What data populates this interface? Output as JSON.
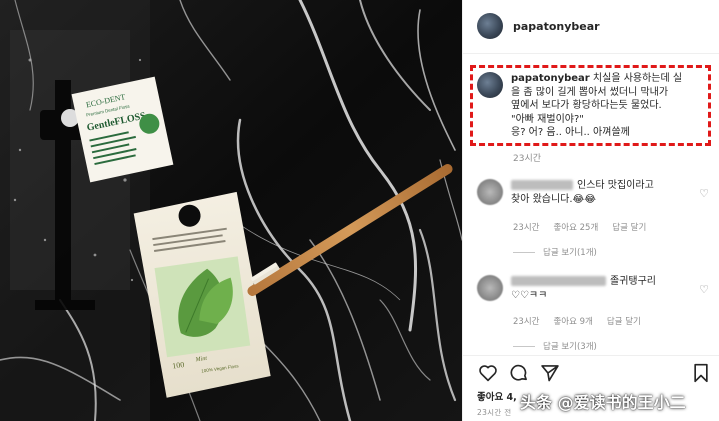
{
  "post": {
    "author": "papatonybear",
    "caption_author": "papatonybear",
    "caption_lines": [
      "치실을 사용하는데 실",
      "을 좀 많이 길게 뽑아서 썼더니 막내가",
      "옆에서 보다가 황당하다는듯 물었다.",
      "\"아빠 재벌이야?\"",
      "응? 어? 음.. 아니.. 아껴쓸께"
    ],
    "caption_time": "23시간",
    "likes_label": "좋아요 4,",
    "posted_ago": "23시간 전"
  },
  "photo": {
    "label_brand": "ECO-DENT",
    "label_sub": "Premium Dental Floss",
    "label_product": "GentleFLOSS",
    "packet_text_1": "Mint",
    "packet_text_2": "100% Vegan Floss",
    "packet_count": "100"
  },
  "comments": [
    {
      "text_line1": "인스타 맛집이라고",
      "text_line2": "찾아 왔습니다.😂😂",
      "time": "23시간",
      "likes": "좋아요 25개",
      "reply": "답글 달기",
      "view_replies": "답글 보기(1개)"
    },
    {
      "text_line1": "졸귀탱구리",
      "text_line2": "♡♡ㅋㅋ",
      "time": "23시간",
      "likes": "좋아요 9개",
      "reply": "답글 달기",
      "view_replies": "답글 보기(3개)"
    }
  ],
  "icons": [
    "heart-icon",
    "comment-icon",
    "share-icon",
    "bookmark-icon"
  ],
  "watermark": "头条 @爱读书的王小二",
  "colors": {
    "highlight": "#e01919",
    "muted": "#8e8e8e",
    "text": "#262626"
  }
}
